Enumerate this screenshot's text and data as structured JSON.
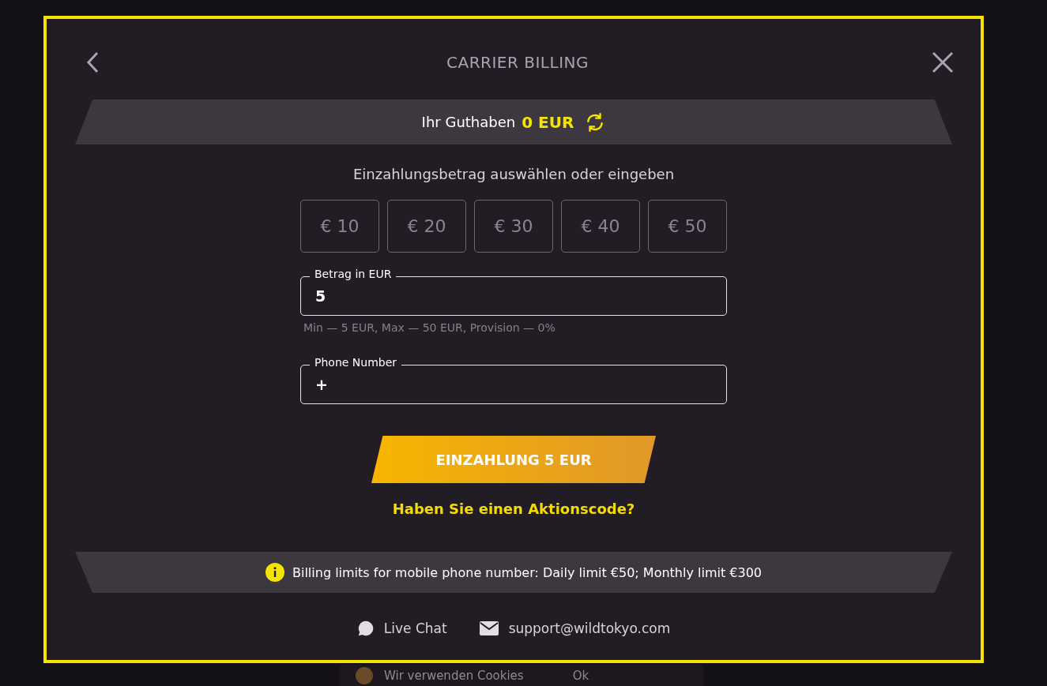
{
  "header": {
    "title": "CARRIER BILLING"
  },
  "balance": {
    "label": "Ihr Guthaben",
    "amount": "0 EUR"
  },
  "prompt": "Einzahlungsbetrag auswählen oder eingeben",
  "amounts": [
    {
      "label": "€ 10",
      "selected": false
    },
    {
      "label": "€ 20",
      "selected": false
    },
    {
      "label": "€ 30",
      "selected": false
    },
    {
      "label": "€ 40",
      "selected": false
    },
    {
      "label": "€ 50",
      "selected": false
    }
  ],
  "amount_field": {
    "label": "Betrag in EUR",
    "value": "5"
  },
  "hint": "Min — 5 EUR, Max — 50 EUR, Provision — 0%",
  "phone_field": {
    "label": "Phone Number",
    "value": "+"
  },
  "deposit_button": "EINZAHLUNG 5 EUR",
  "promo_link": "Haben Sie einen Aktionscode?",
  "notice": "Billing limits for mobile phone number: Daily limit €50; Monthly limit €300",
  "footer": [
    {
      "kind": "chat",
      "label": "Live Chat"
    },
    {
      "kind": "email",
      "label": "support@wildtokyo.com"
    }
  ],
  "cookie_bar": {
    "text": "Wir verwenden Cookies",
    "button": "Ok"
  }
}
